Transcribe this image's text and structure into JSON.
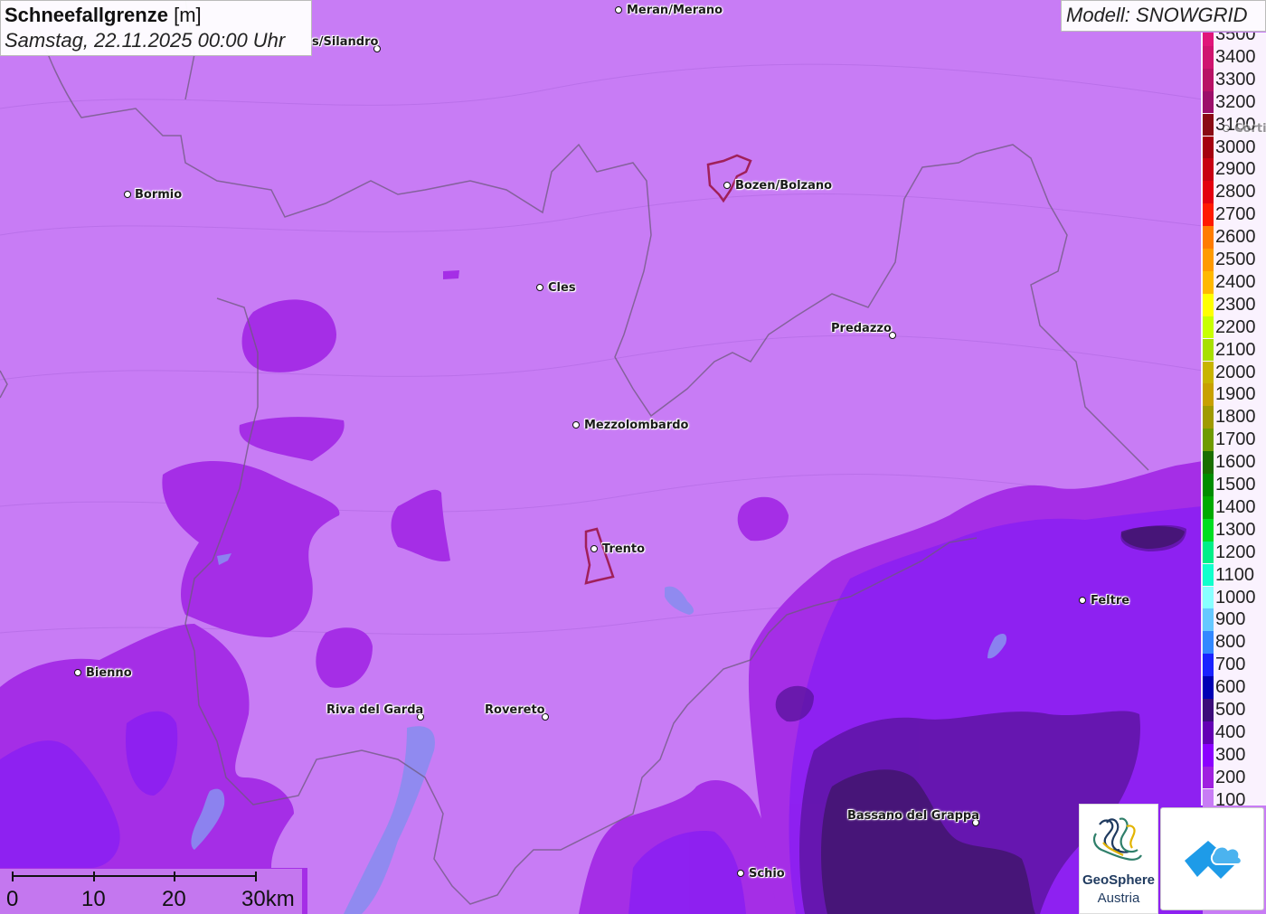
{
  "header": {
    "title": "Schneefallgrenze",
    "unit": "[m]",
    "subtitle": "Samstag, 22.11.2025 00:00 Uhr"
  },
  "model": {
    "label": "Modell: SNOWGRID"
  },
  "legend": {
    "items": [
      {
        "label": "3500",
        "color": "#e0157a"
      },
      {
        "label": "3400",
        "color": "#cf1470"
      },
      {
        "label": "3300",
        "color": "#b81266"
      },
      {
        "label": "3200",
        "color": "#9c0f6a"
      },
      {
        "label": "3100",
        "color": "#8a0a14"
      },
      {
        "label": "3000",
        "color": "#a50010"
      },
      {
        "label": "2900",
        "color": "#c80012"
      },
      {
        "label": "2800",
        "color": "#e3000f"
      },
      {
        "label": "2700",
        "color": "#ff1a00"
      },
      {
        "label": "2600",
        "color": "#ff7c00"
      },
      {
        "label": "2500",
        "color": "#ff9a00"
      },
      {
        "label": "2400",
        "color": "#ffb800"
      },
      {
        "label": "2300",
        "color": "#ffff00"
      },
      {
        "label": "2200",
        "color": "#c8ff00"
      },
      {
        "label": "2100",
        "color": "#a8df00"
      },
      {
        "label": "2000",
        "color": "#c8b400"
      },
      {
        "label": "1900",
        "color": "#c8a000"
      },
      {
        "label": "1800",
        "color": "#a09a00"
      },
      {
        "label": "1700",
        "color": "#6f9a00"
      },
      {
        "label": "1600",
        "color": "#1a6e00"
      },
      {
        "label": "1500",
        "color": "#008c00"
      },
      {
        "label": "1400",
        "color": "#00aa00"
      },
      {
        "label": "1300",
        "color": "#00dd22"
      },
      {
        "label": "1200",
        "color": "#00ee88"
      },
      {
        "label": "1100",
        "color": "#11ffcc"
      },
      {
        "label": "1000",
        "color": "#88ffff"
      },
      {
        "label": "900",
        "color": "#66c8ff"
      },
      {
        "label": "800",
        "color": "#3388ff"
      },
      {
        "label": "700",
        "color": "#1a22ff"
      },
      {
        "label": "600",
        "color": "#0000b4"
      },
      {
        "label": "500",
        "color": "#3c0c7a"
      },
      {
        "label": "400",
        "color": "#6400b4"
      },
      {
        "label": "300",
        "color": "#8c00ff"
      },
      {
        "label": "200",
        "color": "#a020e0"
      },
      {
        "label": "100",
        "color": "#c87cf5"
      }
    ]
  },
  "cities": [
    {
      "name": "Meran/Merano"
    },
    {
      "name": "s/Silandro"
    },
    {
      "name": "Bormio"
    },
    {
      "name": "Bozen/Bolzano"
    },
    {
      "name": "Cles"
    },
    {
      "name": "Predazzo"
    },
    {
      "name": "Mezzolombardo"
    },
    {
      "name": "Trento"
    },
    {
      "name": "Feltre"
    },
    {
      "name": "Bienno"
    },
    {
      "name": "Riva del Garda"
    },
    {
      "name": "Rovereto"
    },
    {
      "name": "Bassano del Grappa"
    },
    {
      "name": "Schio"
    },
    {
      "name": "Corti"
    }
  ],
  "scale": {
    "ticks": [
      "0",
      "10",
      "20",
      "30km"
    ]
  },
  "logos": {
    "geosphere_name": "GeoSphere",
    "geosphere_sub": "Austria",
    "app_icon": "weather-app-icon"
  },
  "colors": {
    "base_100": "#c87cf5",
    "band_200": "#a020e0",
    "band_300": "#8c00ff",
    "band_400": "#6400b4",
    "band_500": "#3c0c7a"
  }
}
